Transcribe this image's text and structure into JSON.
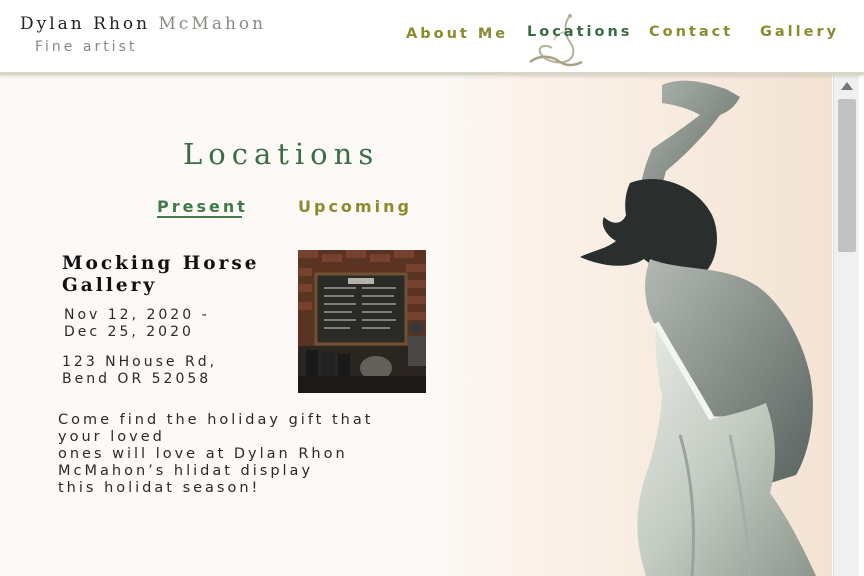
{
  "header": {
    "brand_first": "Dylan Rhon",
    "brand_last": "McMahon",
    "tagline": "Fine artist"
  },
  "nav": {
    "items": [
      {
        "label": "About Me"
      },
      {
        "label": "Locations",
        "active": true
      },
      {
        "label": "Contact"
      },
      {
        "label": "Gallery"
      }
    ]
  },
  "main": {
    "title": "Locations",
    "tabs": [
      {
        "label": "Present",
        "active": true
      },
      {
        "label": "Upcoming"
      }
    ],
    "event": {
      "venue_line1": "Mocking Horse",
      "venue_line2": "Gallery",
      "dates_line1": "Nov 12, 2020 -",
      "dates_line2": "Dec 25, 2020",
      "address_line1": "123 NHouse Rd,",
      "address_line2": "Bend OR 52058",
      "description_lines": [
        "Come find the holiday gift that",
        "your loved",
        "ones will love at Dylan Rhon",
        "McMahon’s hlidat display",
        "this holidat season!"
      ]
    }
  },
  "colors": {
    "accent_green": "#3a6e45",
    "nav_olive": "#8b8a2c",
    "background": "#fdf9f6"
  },
  "icons": {
    "logo": "swirl-ornament-icon",
    "scroll_up": "scroll-up-arrow-icon"
  }
}
